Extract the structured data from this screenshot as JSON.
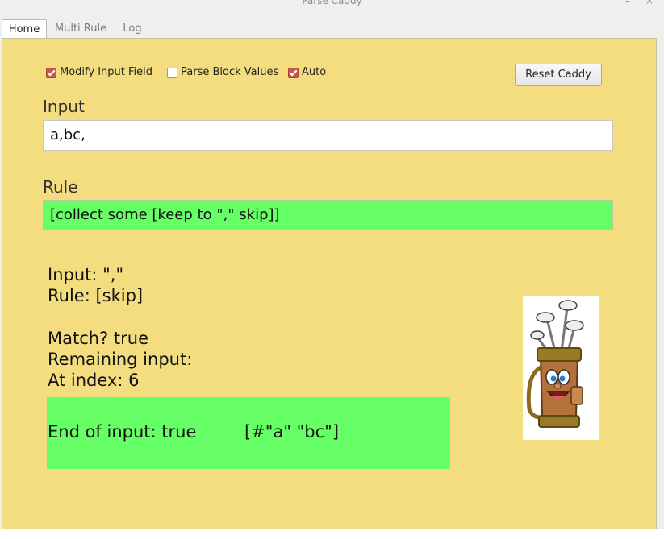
{
  "window": {
    "title": "Parse Caddy",
    "minimize_glyph": "–",
    "close_glyph": "×"
  },
  "tabs": [
    {
      "label": "Home",
      "active": true
    },
    {
      "label": "Multi Rule",
      "active": false
    },
    {
      "label": "Log",
      "active": false
    }
  ],
  "options": {
    "modify_input_field": {
      "label": "Modify Input Field",
      "checked": true
    },
    "parse_block_values": {
      "label": "Parse Block Values",
      "checked": false
    },
    "auto": {
      "label": "Auto",
      "checked": true
    },
    "reset_label": "Reset Caddy"
  },
  "input": {
    "label": "Input",
    "value": "a,bc,"
  },
  "rule": {
    "label": "Rule",
    "value": "[collect some [keep to \",\" skip]]"
  },
  "status": {
    "input_line": "Input: \",\"",
    "rule_line": "Rule: [skip]",
    "match_line": "Match? true",
    "remaining_line": "Remaining input:",
    "index_line": "At index: 6"
  },
  "result": {
    "end_label": "End of input: true",
    "value": "[#\"a\" \"bc\"]"
  },
  "colors": {
    "panel_bg": "#f4dd7f",
    "match_green": "#66ff66",
    "checkbox_accent": "#c25a4f"
  },
  "mascot": {
    "icon": "golf-bag-mascot-icon"
  }
}
